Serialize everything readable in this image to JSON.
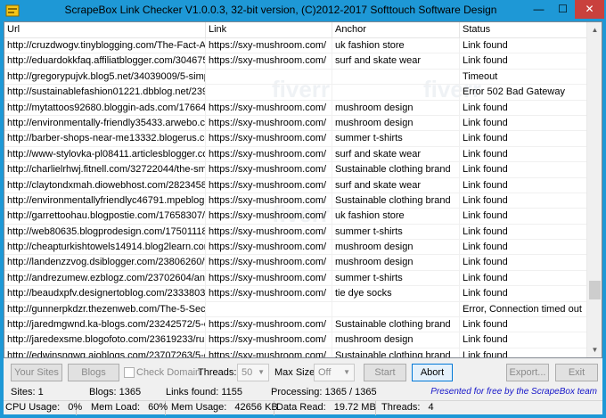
{
  "window": {
    "title": "ScrapeBox Link Checker V1.0.0.3, 32-bit version, (C)2012-2017 Softtouch Software Design",
    "min_glyph": "—",
    "max_glyph": "☐",
    "close_glyph": "✕"
  },
  "grid": {
    "columns": [
      "Url",
      "Link",
      "Anchor",
      "Status"
    ],
    "rows": [
      [
        "http://cruzdwogv.tinyblogging.com/The-Fact-About-",
        "https://sxy-mushroom.com/",
        "uk fashion store",
        "Link found"
      ],
      [
        "http://eduardokkfaq.affiliatblogger.com/30467543/",
        "https://sxy-mushroom.com/",
        "surf and skate wear",
        "Link found"
      ],
      [
        "http://gregorypujvk.blog5.net/34039009/5-simple-",
        "",
        "",
        "Timeout"
      ],
      [
        "http://sustainablefashion01221.dbblog.net/239711",
        "",
        "",
        "Error 502 Bad Gateway"
      ],
      [
        "http://mytattoos92680.bloggin-ads.com/17664230",
        "https://sxy-mushroom.com/",
        "mushroom design",
        "Link found"
      ],
      [
        "http://environmentally-friendly35433.arwebo.com/",
        "https://sxy-mushroom.com/",
        "mushroom design",
        "Link found"
      ],
      [
        "http://barber-shops-near-me13332.blogerus.com/1",
        "https://sxy-mushroom.com/",
        "summer t-shirts",
        "Link found"
      ],
      [
        "http://www-stylovka-pl08411.articlesblogger.com/",
        "https://sxy-mushroom.com/",
        "surf and skate wear",
        "Link found"
      ],
      [
        "http://charlielrhwj.fitnell.com/32722044/the-smart",
        "https://sxy-mushroom.com/",
        "Sustainable clothing brand",
        "Link found"
      ],
      [
        "http://claytondxmah.diowebhost.com/28234588/t",
        "https://sxy-mushroom.com/",
        "surf and skate wear",
        "Link found"
      ],
      [
        "http://environmentallyfriendlyc46791.mpeblog.com",
        "https://sxy-mushroom.com/",
        "Sustainable clothing brand",
        "Link found"
      ],
      [
        "http://garrettoohau.blogpostie.com/17658307/the",
        "https://sxy-mushroom.com/",
        "uk fashion store",
        "Link found"
      ],
      [
        "http://web80635.blogprodesign.com/17501118/th",
        "https://sxy-mushroom.com/",
        "summer t-shirts",
        "Link found"
      ],
      [
        "http://cheapturkishtowels14914.blog2learn.com/3",
        "https://sxy-mushroom.com/",
        "mushroom design",
        "Link found"
      ],
      [
        "http://landenzzvog.dsiblogger.com/23806260/the-",
        "https://sxy-mushroom.com/",
        "mushroom design",
        "Link found"
      ],
      [
        "http://andrezumew.ezblogz.com/23702604/an-unl",
        "https://sxy-mushroom.com/",
        "summer t-shirts",
        "Link found"
      ],
      [
        "http://beaudxpfv.designertoblog.com/23338032/li",
        "https://sxy-mushroom.com/",
        "tie dye socks",
        "Link found"
      ],
      [
        "http://gunnerpkdzr.thezenweb.com/The-5-Second",
        "",
        "",
        "Error, Connection timed out"
      ],
      [
        "http://jaredmgwnd.ka-blogs.com/23242572/5-esse",
        "https://sxy-mushroom.com/",
        "Sustainable clothing brand",
        "Link found"
      ],
      [
        "http://jaredexsme.blogofoto.com/23619233/rumo",
        "https://sxy-mushroom.com/",
        "mushroom design",
        "Link found"
      ],
      [
        "http://edwinsngwg.aioblogs.com/23707263/5-easy",
        "https://sxy-mushroom.com/",
        "Sustainable clothing brand",
        "Link found"
      ]
    ],
    "scroll_position": 0.85,
    "scroll_thumb_fraction": 0.06,
    "watermark": "fiverr"
  },
  "controls": {
    "your_sites": "Your Sites",
    "blogs": "Blogs",
    "check_domain": "Check Domain",
    "threads_label": "Threads:",
    "threads_value": "50",
    "max_size_label": "Max Size:",
    "max_size_value": "Off",
    "start": "Start",
    "abort": "Abort",
    "export": "Export...",
    "exit": "Exit"
  },
  "stats": {
    "sites": "Sites:  1",
    "blogs": "Blogs: 1365",
    "links_found": "Links found:  1155",
    "processing": "Processing:  1365 / 1365",
    "promo": "Presented for free by the ScrapeBox team"
  },
  "statusbar": {
    "cpu_label": "CPU Usage:",
    "cpu_value": "0%",
    "mem_load_label": "Mem Load:",
    "mem_load_value": "60%",
    "mem_usage_label": "Mem Usage:",
    "mem_usage_value": "42656 KB",
    "data_read_label": "Data Read:",
    "data_read_value": "19.72 MB",
    "threads_label": "Threads:",
    "threads_value": "4"
  }
}
